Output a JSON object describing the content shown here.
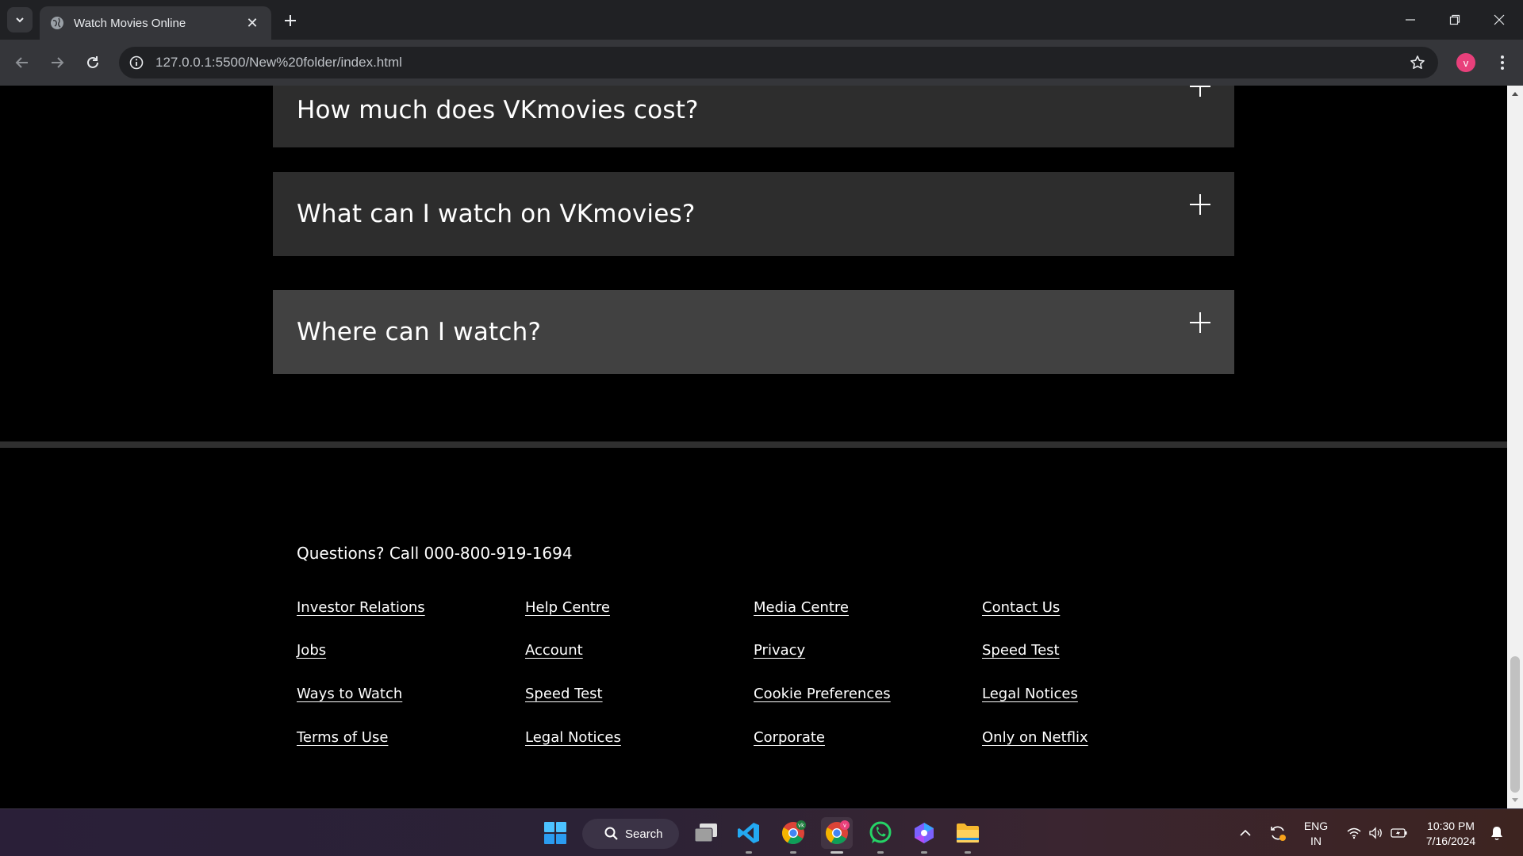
{
  "browser": {
    "tab_title": "Watch Movies Online",
    "url": "127.0.0.1:5500/New%20folder/index.html",
    "profile_initial": "v"
  },
  "faq": {
    "items": [
      {
        "question": "How much does VKmovies cost?"
      },
      {
        "question": "What can I watch on VKmovies?"
      },
      {
        "question": "Where can I watch?"
      }
    ]
  },
  "footer": {
    "question": "Questions? Call 000-800-919-1694",
    "columns": [
      [
        "Investor Relations",
        "Jobs",
        "Ways to Watch",
        "Terms of Use"
      ],
      [
        "Help Centre",
        "Account",
        "Speed Test",
        "Legal Notices"
      ],
      [
        "Media Centre",
        "Privacy",
        "Cookie Preferences",
        "Corporate"
      ],
      [
        "Contact Us",
        "Speed Test",
        "Legal Notices",
        "Only on Netflix"
      ]
    ]
  },
  "taskbar": {
    "search_label": "Search",
    "language": "ENG",
    "region": "IN",
    "time": "10:30 PM",
    "date": "7/16/2024"
  },
  "colors": {
    "faq_bg": "#2d2d2d",
    "faq_hover_bg": "#414141",
    "page_bg": "#000000",
    "profile": "#e8407b"
  }
}
